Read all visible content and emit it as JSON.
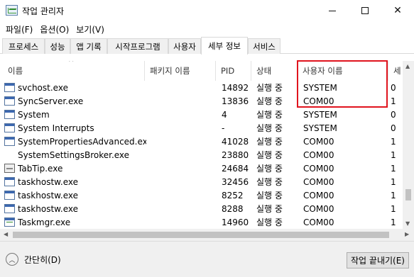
{
  "window": {
    "title": "작업 관리자"
  },
  "menu": [
    "파일(F)",
    "옵션(O)",
    "보기(V)"
  ],
  "tabs": [
    {
      "label": "프로세스",
      "active": false
    },
    {
      "label": "성능",
      "active": false
    },
    {
      "label": "앱 기록",
      "active": false
    },
    {
      "label": "시작프로그램",
      "active": false
    },
    {
      "label": "사용자",
      "active": false
    },
    {
      "label": "세부 정보",
      "active": true
    },
    {
      "label": "서비스",
      "active": false
    }
  ],
  "columns": {
    "name": "이름",
    "package": "패키지 이름",
    "pid": "PID",
    "status": "상태",
    "user": "사용자 이름",
    "desc": "세"
  },
  "rows": [
    {
      "name": "svchost.exe",
      "pid": "14892",
      "status": "실행 중",
      "user": "SYSTEM",
      "desc": "0",
      "icon": "window-icon"
    },
    {
      "name": "SyncServer.exe",
      "pid": "13836",
      "status": "실행 중",
      "user": "COM00",
      "desc": "1",
      "icon": "window-icon"
    },
    {
      "name": "System",
      "pid": "4",
      "status": "실행 중",
      "user": "SYSTEM",
      "desc": "0",
      "icon": "window-icon"
    },
    {
      "name": "System Interrupts",
      "pid": "-",
      "status": "실행 중",
      "user": "SYSTEM",
      "desc": "0",
      "icon": "window-icon"
    },
    {
      "name": "SystemPropertiesAdvanced.exe",
      "pid": "41028",
      "status": "실행 중",
      "user": "COM00",
      "desc": "1",
      "icon": "system-properties-icon"
    },
    {
      "name": "SystemSettingsBroker.exe",
      "pid": "23880",
      "status": "실행 중",
      "user": "COM00",
      "desc": "1",
      "icon": "gear-icon"
    },
    {
      "name": "TabTip.exe",
      "pid": "24684",
      "status": "실행 중",
      "user": "COM00",
      "desc": "1",
      "icon": "keyboard-icon"
    },
    {
      "name": "taskhostw.exe",
      "pid": "32456",
      "status": "실행 중",
      "user": "COM00",
      "desc": "1",
      "icon": "window-icon"
    },
    {
      "name": "taskhostw.exe",
      "pid": "8252",
      "status": "실행 중",
      "user": "COM00",
      "desc": "1",
      "icon": "window-icon"
    },
    {
      "name": "taskhostw.exe",
      "pid": "8288",
      "status": "실행 중",
      "user": "COM00",
      "desc": "1",
      "icon": "window-icon"
    },
    {
      "name": "Taskmgr.exe",
      "pid": "14960",
      "status": "실행 중",
      "user": "COM00",
      "desc": "1",
      "icon": "task-manager-icon"
    }
  ],
  "footer": {
    "less_label": "간단히(D)",
    "end_task_label": "작업 끝내기(E)"
  },
  "colors": {
    "highlight": "#e0141e",
    "header_text": "#333333"
  }
}
